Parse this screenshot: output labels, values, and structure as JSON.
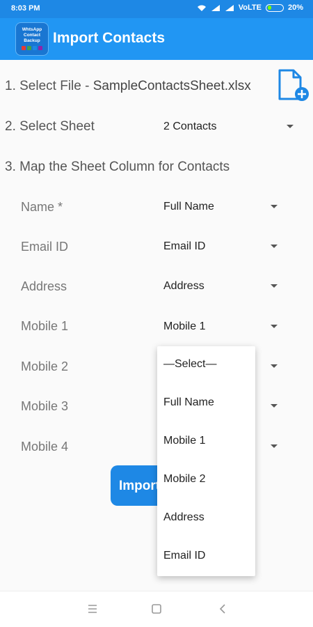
{
  "status_bar": {
    "time": "8:03 PM",
    "network": "VoLTE",
    "battery": "20%"
  },
  "app_bar": {
    "title": "Import Contacts",
    "logo_text": [
      "WhtsApp",
      "Contact",
      "Backup"
    ]
  },
  "steps": {
    "select_file_label": "1. Select File  -  ",
    "file_name": "SampleContactsSheet.xlsx",
    "select_sheet_label": "2. Select Sheet",
    "sheet_value": "2 Contacts",
    "map_label": "3. Map the Sheet Column for Contacts"
  },
  "fields": [
    {
      "label": "Name *",
      "value": "Full Name"
    },
    {
      "label": "Email ID",
      "value": "Email ID"
    },
    {
      "label": "Address",
      "value": "Address"
    },
    {
      "label": "Mobile 1",
      "value": "Mobile 1"
    },
    {
      "label": "Mobile 2",
      "value": ""
    },
    {
      "label": "Mobile 3",
      "value": ""
    },
    {
      "label": "Mobile 4",
      "value": ""
    }
  ],
  "import_button": "Import",
  "dropdown_options": [
    "—Select—",
    "Full Name",
    "Mobile 1",
    "Mobile 2",
    "Address",
    "Email ID"
  ],
  "colors": {
    "primary": "#2196f3",
    "status": "#1e88e5",
    "button": "#1e88e5"
  },
  "icons": [
    "wifi-icon",
    "signal-icon",
    "battery-icon",
    "add-file-icon",
    "menu-icon",
    "home-icon",
    "back-icon"
  ]
}
